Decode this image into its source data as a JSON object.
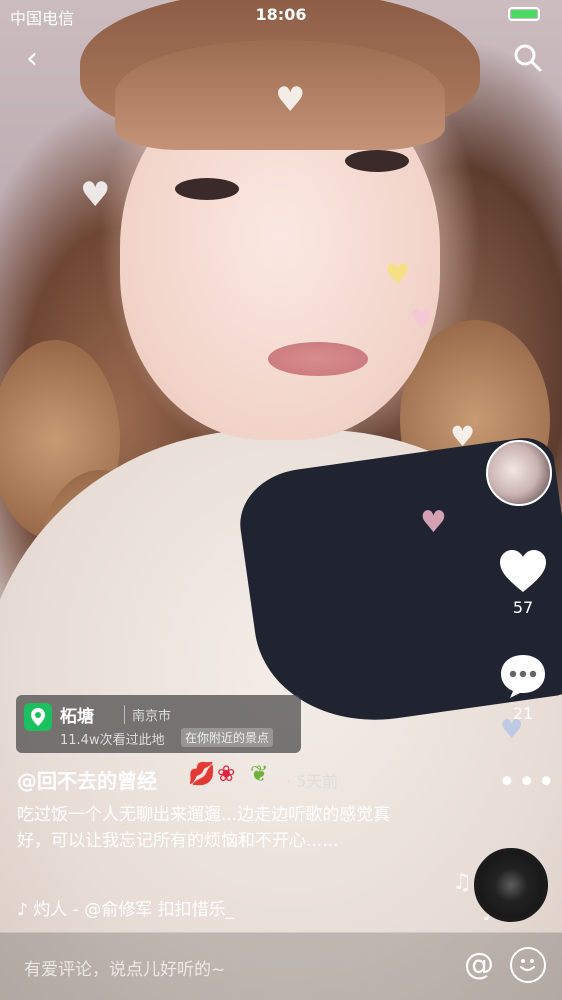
{
  "status_bar": {
    "carrier": "中国电信",
    "time": "18:06"
  },
  "location": {
    "name": "柘塘",
    "city": "南京市",
    "visits": "11.4w次看过此地",
    "tag": "在你附近的景点"
  },
  "post": {
    "author": "@回不去的曾经",
    "time_ago": "· 5天前",
    "caption": "吃过饭一个人无聊出来遛遛...边走边听歌的感觉真好，可以让我忘记所有的烦恼和不开心......",
    "music": "灼人 - @俞修军    扣扣惜乐_"
  },
  "actions": {
    "likes": "57",
    "comments": "21"
  },
  "comment_bar": {
    "placeholder": "有爱评论，说点儿好听的~"
  },
  "icons": [
    "back-icon",
    "search-icon",
    "heart-icon",
    "comment-icon",
    "more-icon",
    "location-pin-icon",
    "music-note-icon",
    "at-icon",
    "emoji-icon"
  ],
  "colors": {
    "accent_green": "#1bc15f",
    "battery": "#4cd964"
  }
}
